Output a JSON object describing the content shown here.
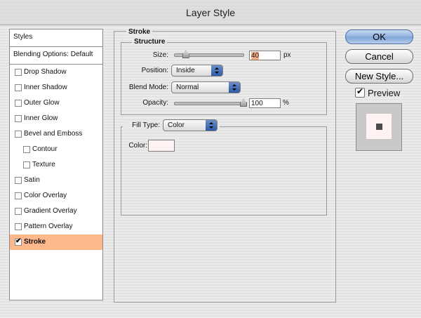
{
  "window": {
    "title": "Layer Style"
  },
  "styles_list": {
    "header": "Styles",
    "blending": "Blending Options: Default",
    "items": [
      {
        "label": "Drop Shadow",
        "checked": false,
        "sub": false
      },
      {
        "label": "Inner Shadow",
        "checked": false,
        "sub": false
      },
      {
        "label": "Outer Glow",
        "checked": false,
        "sub": false
      },
      {
        "label": "Inner Glow",
        "checked": false,
        "sub": false
      },
      {
        "label": "Bevel and Emboss",
        "checked": false,
        "sub": false
      },
      {
        "label": "Contour",
        "checked": false,
        "sub": true
      },
      {
        "label": "Texture",
        "checked": false,
        "sub": true
      },
      {
        "label": "Satin",
        "checked": false,
        "sub": false
      },
      {
        "label": "Color Overlay",
        "checked": false,
        "sub": false
      },
      {
        "label": "Gradient Overlay",
        "checked": false,
        "sub": false
      },
      {
        "label": "Pattern Overlay",
        "checked": false,
        "sub": false
      },
      {
        "label": "Stroke",
        "checked": true,
        "sub": false,
        "selected": true
      }
    ]
  },
  "stroke": {
    "title": "Stroke",
    "structure": {
      "title": "Structure",
      "size_label": "Size:",
      "size_value": "40",
      "size_unit": "px",
      "size_slider": 0.16,
      "position_label": "Position:",
      "position_value": "Inside",
      "blend_label": "Blend Mode:",
      "blend_value": "Normal",
      "opacity_label": "Opacity:",
      "opacity_value": "100",
      "opacity_unit": "%",
      "opacity_slider": 1.0
    },
    "fill": {
      "type_label": "Fill Type:",
      "type_value": "Color",
      "color_label": "Color:",
      "color_value": "#fff2f2"
    }
  },
  "buttons": {
    "ok": "OK",
    "cancel": "Cancel",
    "new_style": "New Style...",
    "preview": "Preview"
  },
  "colors": {
    "accent_selection": "#ffb78c",
    "preview_fill": "#4a4a4a"
  }
}
